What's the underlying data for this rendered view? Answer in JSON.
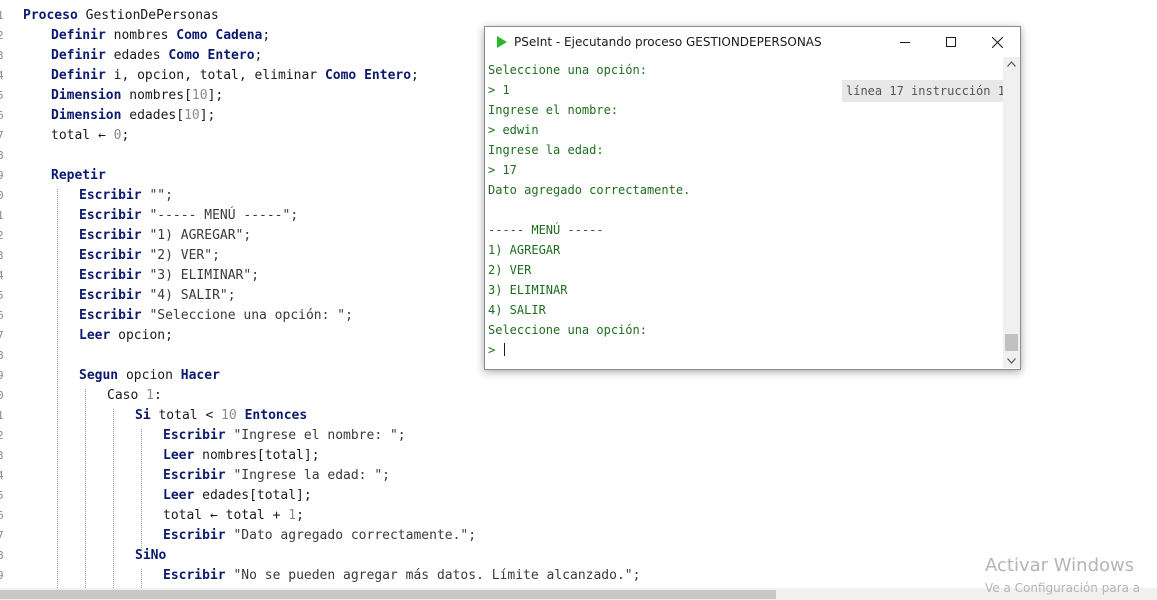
{
  "editor": {
    "line_numbers": [
      "1",
      "2",
      "3",
      "4",
      "5",
      "6",
      "7",
      "8",
      "9",
      "0",
      "1",
      "2",
      "3",
      "4",
      "5",
      "6",
      "7",
      "8",
      "9",
      "0",
      "1",
      "2",
      "3",
      "4",
      "5",
      "6",
      "7",
      "8",
      "9"
    ],
    "lines": [
      [
        {
          "t": "Proceso",
          "c": "kw"
        },
        {
          "t": " GestionDePersonas",
          "c": "ident"
        }
      ],
      [
        {
          "t": "Definir",
          "c": "kw"
        },
        {
          "t": " nombres ",
          "c": "ident"
        },
        {
          "t": "Como Cadena",
          "c": "kw"
        },
        {
          "t": ";",
          "c": "ident"
        }
      ],
      [
        {
          "t": "Definir",
          "c": "kw"
        },
        {
          "t": " edades ",
          "c": "ident"
        },
        {
          "t": "Como Entero",
          "c": "kw"
        },
        {
          "t": ";",
          "c": "ident"
        }
      ],
      [
        {
          "t": "Definir",
          "c": "kw"
        },
        {
          "t": " i, opcion, total, eliminar ",
          "c": "ident"
        },
        {
          "t": "Como Entero",
          "c": "kw"
        },
        {
          "t": ";",
          "c": "ident"
        }
      ],
      [
        {
          "t": "Dimension",
          "c": "kw"
        },
        {
          "t": " nombres[",
          "c": "ident"
        },
        {
          "t": "10",
          "c": "num"
        },
        {
          "t": "];",
          "c": "ident"
        }
      ],
      [
        {
          "t": "Dimension",
          "c": "kw"
        },
        {
          "t": " edades[",
          "c": "ident"
        },
        {
          "t": "10",
          "c": "num"
        },
        {
          "t": "];",
          "c": "ident"
        }
      ],
      [
        {
          "t": "total ← ",
          "c": "ident"
        },
        {
          "t": "0",
          "c": "num"
        },
        {
          "t": ";",
          "c": "ident"
        }
      ],
      [],
      [
        {
          "t": "Repetir",
          "c": "kw"
        }
      ],
      [
        {
          "t": "Escribir",
          "c": "kw"
        },
        {
          "t": " \"\";",
          "c": "str"
        }
      ],
      [
        {
          "t": "Escribir",
          "c": "kw"
        },
        {
          "t": " \"----- MENÚ -----\";",
          "c": "str"
        }
      ],
      [
        {
          "t": "Escribir",
          "c": "kw"
        },
        {
          "t": " \"1) AGREGAR\";",
          "c": "str"
        }
      ],
      [
        {
          "t": "Escribir",
          "c": "kw"
        },
        {
          "t": " \"2) VER\";",
          "c": "str"
        }
      ],
      [
        {
          "t": "Escribir",
          "c": "kw"
        },
        {
          "t": " \"3) ELIMINAR\";",
          "c": "str"
        }
      ],
      [
        {
          "t": "Escribir",
          "c": "kw"
        },
        {
          "t": " \"4) SALIR\";",
          "c": "str"
        }
      ],
      [
        {
          "t": "Escribir",
          "c": "kw"
        },
        {
          "t": " \"Seleccione una opción: \";",
          "c": "str"
        }
      ],
      [
        {
          "t": "Leer",
          "c": "kw"
        },
        {
          "t": " opcion;",
          "c": "ident"
        }
      ],
      [],
      [
        {
          "t": "Segun",
          "c": "kw"
        },
        {
          "t": " opcion ",
          "c": "ident"
        },
        {
          "t": "Hacer",
          "c": "kw"
        }
      ],
      [
        {
          "t": "Caso ",
          "c": "ident"
        },
        {
          "t": "1",
          "c": "num"
        },
        {
          "t": ":",
          "c": "ident"
        }
      ],
      [
        {
          "t": "Si",
          "c": "kw"
        },
        {
          "t": " total < ",
          "c": "ident"
        },
        {
          "t": "10",
          "c": "num"
        },
        {
          "t": " ",
          "c": "ident"
        },
        {
          "t": "Entonces",
          "c": "kw"
        }
      ],
      [
        {
          "t": "Escribir",
          "c": "kw"
        },
        {
          "t": " \"Ingrese el nombre: \";",
          "c": "str"
        }
      ],
      [
        {
          "t": "Leer",
          "c": "kw"
        },
        {
          "t": " nombres[total];",
          "c": "ident"
        }
      ],
      [
        {
          "t": "Escribir",
          "c": "kw"
        },
        {
          "t": " \"Ingrese la edad: \";",
          "c": "str"
        }
      ],
      [
        {
          "t": "Leer",
          "c": "kw"
        },
        {
          "t": " edades[total];",
          "c": "ident"
        }
      ],
      [
        {
          "t": "total ← total + ",
          "c": "ident"
        },
        {
          "t": "1",
          "c": "num"
        },
        {
          "t": ";",
          "c": "ident"
        }
      ],
      [
        {
          "t": "Escribir",
          "c": "kw"
        },
        {
          "t": " \"Dato agregado correctamente.\";",
          "c": "str"
        }
      ],
      [
        {
          "t": "SiNo",
          "c": "kw"
        }
      ],
      [
        {
          "t": "Escribir",
          "c": "kw"
        },
        {
          "t": " \"No se pueden agregar más datos. Límite alcanzado.\";",
          "c": "str"
        }
      ]
    ]
  },
  "console_window": {
    "title": "PSeInt - Ejecutando proceso GESTIONDEPERSONAS",
    "status": "línea 17 instrucción 1",
    "lines": [
      "Seleccione una opción:",
      "> 1",
      "Ingrese el nombre:",
      "> edwin",
      "Ingrese la edad:",
      "> 17",
      "Dato agregado correctamente.",
      "",
      "----- MENÚ -----",
      "1) AGREGAR",
      "2) VER",
      "3) ELIMINAR",
      "4) SALIR",
      "Seleccione una opción:",
      "> "
    ],
    "colors": {
      "output": "#1e6e1e",
      "app_icon": "#2bb52b"
    }
  },
  "watermark": {
    "line1": "Activar Windows",
    "line2": "Ve a Configuración para a"
  }
}
